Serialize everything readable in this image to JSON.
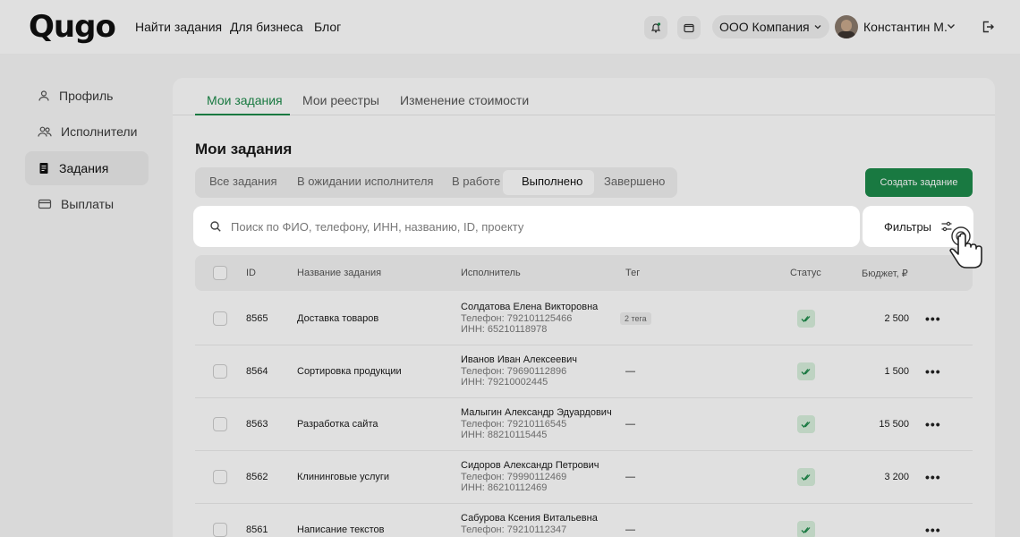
{
  "header": {
    "logo": "Qugo",
    "nav": [
      "Найти задания",
      "Для бизнеса",
      "Блог"
    ],
    "company": "ООО Компания",
    "user_name": "Константин М."
  },
  "sidebar": {
    "items": [
      {
        "label": "Профиль",
        "icon": "user-icon"
      },
      {
        "label": "Исполнители",
        "icon": "users-icon"
      },
      {
        "label": "Задания",
        "icon": "document-icon",
        "active": true
      },
      {
        "label": "Выплаты",
        "icon": "card-icon"
      }
    ]
  },
  "tabs": [
    "Мои задания",
    "Мои реестры",
    "Изменение стоимости"
  ],
  "page_title": "Мои задания",
  "status_filters": [
    "Все задания",
    "В ожидании исполнителя",
    "В работе",
    "Выполнено",
    "Завершено"
  ],
  "status_filter_active": "Выполнено",
  "create_button": "Создать задание",
  "search": {
    "placeholder": "Поиск по ФИО, телефону, ИНН, названию, ID, проекту"
  },
  "filters_button": "Фильтры",
  "table": {
    "headers": {
      "id": "ID",
      "name": "Название задания",
      "executor": "Исполнитель",
      "tag": "Тег",
      "status": "Статус",
      "budget": "Бюджет, ₽"
    },
    "rows": [
      {
        "id": "8565",
        "name": "Доставка товаров",
        "executor": "Солдатова Елена Викторовна",
        "phone": "Телефон: 792101125466",
        "inn": "ИНН: 65210118978",
        "tag": "2 тега",
        "budget": "2 500"
      },
      {
        "id": "8564",
        "name": "Сортировка продукции",
        "executor": "Иванов Иван Алексеевич",
        "phone": "Телефон: 79690112896",
        "inn": "ИНН: 79210002445",
        "tag": "—",
        "budget": "1 500"
      },
      {
        "id": "8563",
        "name": "Разработка сайта",
        "executor": "Малыгин Александр Эдуардович",
        "phone": "Телефон: 79210116545",
        "inn": "ИНН: 88210115445",
        "tag": "—",
        "budget": "15 500"
      },
      {
        "id": "8562",
        "name": "Клининговые услуги",
        "executor": "Сидоров Александр Петрович",
        "phone": "Телефон: 79990112469",
        "inn": "ИНН: 86210112469",
        "tag": "—",
        "budget": "3 200"
      },
      {
        "id": "8561",
        "name": "Написание текстов",
        "executor": "Сабурова Ксения Витальевна",
        "phone": "Телефон: 79210112347",
        "inn": "",
        "tag": "—",
        "budget": ""
      }
    ]
  },
  "colors": {
    "accent": "#1d8a4a",
    "status_ok_bg": "#d9f1dd"
  }
}
